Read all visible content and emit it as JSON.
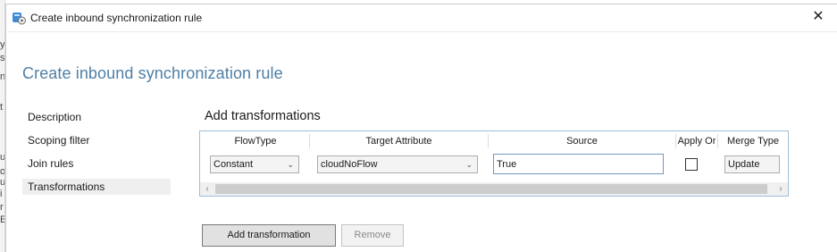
{
  "background_window": {
    "edge_chars": [
      "y",
      "s",
      "n",
      "t",
      "u",
      "o",
      "u",
      "i",
      "r",
      "E"
    ]
  },
  "window": {
    "title": "Create inbound synchronization rule",
    "close_glyph": "✕"
  },
  "page": {
    "heading": "Create inbound synchronization rule"
  },
  "nav": {
    "items": [
      {
        "label": "Description",
        "selected": false
      },
      {
        "label": "Scoping filter",
        "selected": false
      },
      {
        "label": "Join rules",
        "selected": false
      },
      {
        "label": "Transformations",
        "selected": true
      }
    ]
  },
  "transformations": {
    "heading": "Add transformations",
    "columns": [
      "FlowType",
      "Target Attribute",
      "Source",
      "Apply Or",
      "Merge Type"
    ],
    "rows": [
      {
        "flow_type": "Constant",
        "target_attribute": "cloudNoFlow",
        "source": "True",
        "apply_once": false,
        "merge_type": "Update"
      }
    ],
    "scroll_left_glyph": "‹",
    "scroll_right_glyph": "›",
    "dropdown_glyph": "⌄"
  },
  "buttons": {
    "add": "Add transformation",
    "remove": "Remove"
  },
  "colors": {
    "heading_blue": "#4f7fa6",
    "grid_border": "#9fbfd8",
    "selected_nav_bg": "#efefef"
  },
  "icons": {
    "app_icon": "sync-rule-icon",
    "close": "close-icon",
    "dropdown": "chevron-down-icon"
  }
}
